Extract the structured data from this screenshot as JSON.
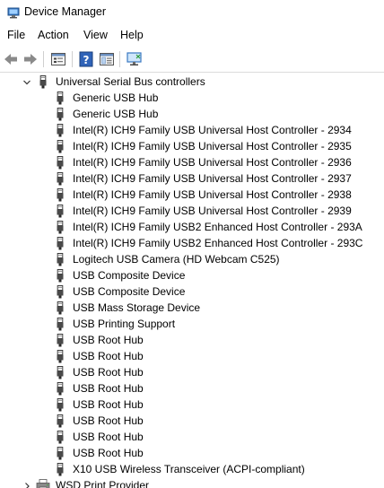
{
  "window": {
    "title": "Device Manager",
    "icon": "device-manager-icon"
  },
  "menu": {
    "items": [
      {
        "label": "File"
      },
      {
        "label": "Action"
      },
      {
        "label": "View"
      },
      {
        "label": "Help"
      }
    ]
  },
  "toolbar": {
    "buttons": [
      {
        "icon": "back-arrow-icon"
      },
      {
        "icon": "forward-arrow-icon"
      },
      {
        "icon": "properties-icon"
      },
      {
        "icon": "help-icon"
      },
      {
        "icon": "show-hide-console-tree-icon"
      },
      {
        "icon": "monitor-scan-icon"
      }
    ]
  },
  "tree": {
    "category": {
      "label": "Universal Serial Bus controllers",
      "expanded": true,
      "icon": "usb-plug-icon"
    },
    "devices": [
      {
        "label": "Generic USB Hub"
      },
      {
        "label": "Generic USB Hub"
      },
      {
        "label": "Intel(R) ICH9 Family USB Universal Host Controller - 2934"
      },
      {
        "label": "Intel(R) ICH9 Family USB Universal Host Controller - 2935"
      },
      {
        "label": "Intel(R) ICH9 Family USB Universal Host Controller - 2936"
      },
      {
        "label": "Intel(R) ICH9 Family USB Universal Host Controller - 2937"
      },
      {
        "label": "Intel(R) ICH9 Family USB Universal Host Controller - 2938"
      },
      {
        "label": "Intel(R) ICH9 Family USB Universal Host Controller - 2939"
      },
      {
        "label": "Intel(R) ICH9 Family USB2 Enhanced Host Controller - 293A"
      },
      {
        "label": "Intel(R) ICH9 Family USB2 Enhanced Host Controller - 293C"
      },
      {
        "label": "Logitech USB Camera (HD Webcam C525)"
      },
      {
        "label": "USB Composite Device"
      },
      {
        "label": "USB Composite Device"
      },
      {
        "label": "USB Mass Storage Device"
      },
      {
        "label": "USB Printing Support"
      },
      {
        "label": "USB Root Hub"
      },
      {
        "label": "USB Root Hub"
      },
      {
        "label": "USB Root Hub"
      },
      {
        "label": "USB Root Hub"
      },
      {
        "label": "USB Root Hub"
      },
      {
        "label": "USB Root Hub"
      },
      {
        "label": "USB Root Hub"
      },
      {
        "label": "USB Root Hub"
      },
      {
        "label": "X10 USB Wireless Transceiver (ACPI-compliant)"
      }
    ],
    "next_category": {
      "label": "WSD Print Provider",
      "expanded": false,
      "icon": "printer-icon"
    }
  }
}
